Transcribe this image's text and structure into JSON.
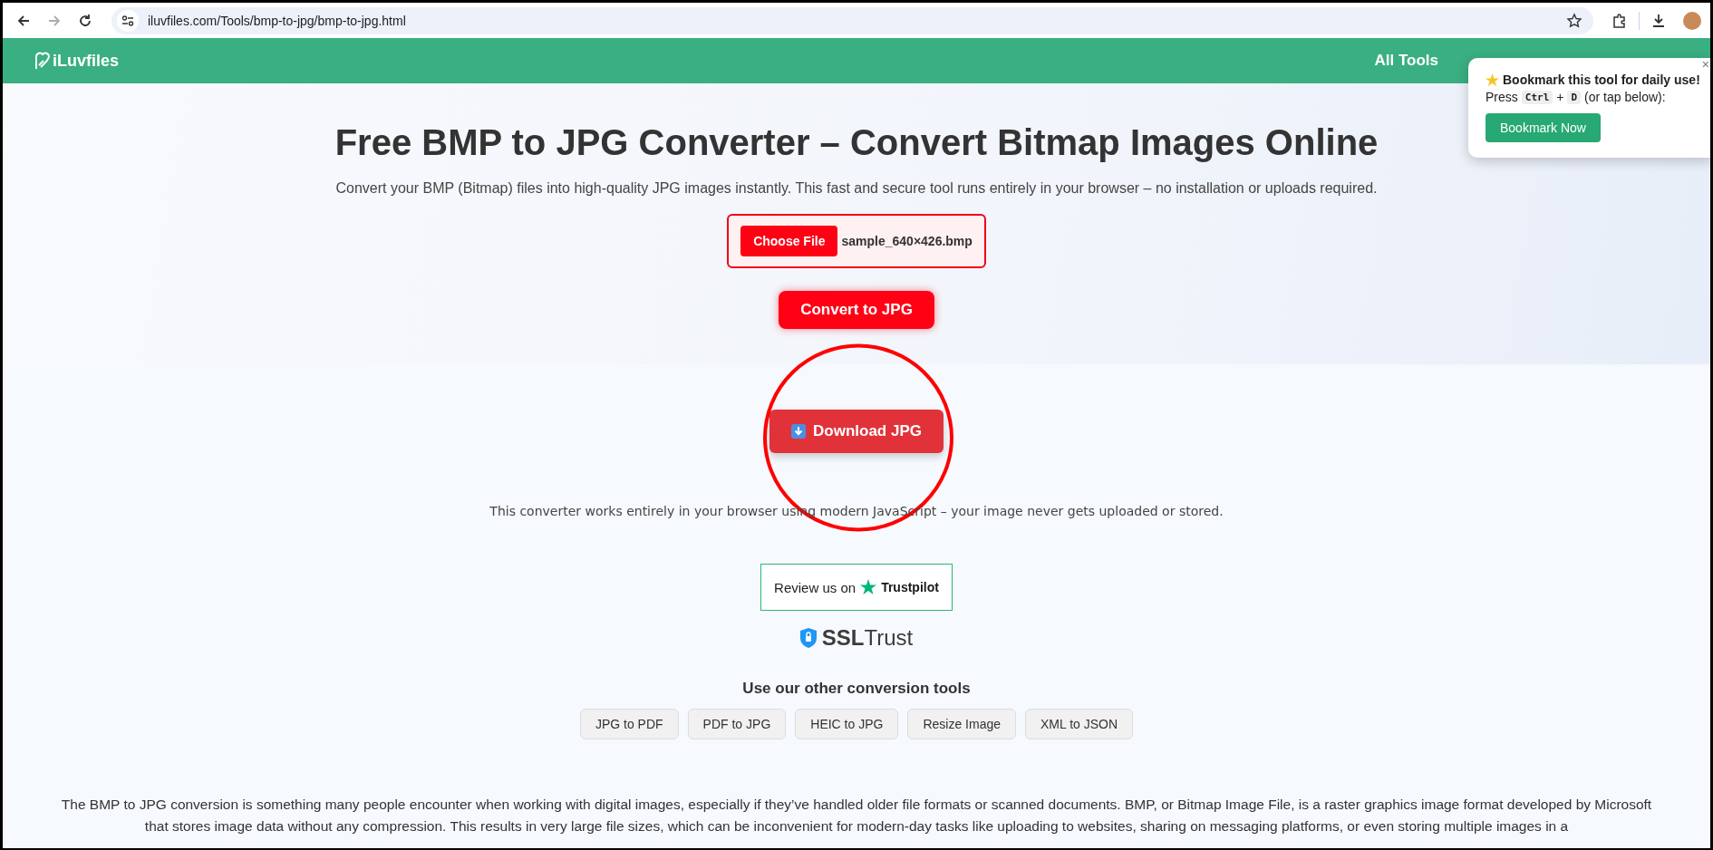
{
  "browser": {
    "url": "iluvfiles.com/Tools/bmp-to-jpg/bmp-to-jpg.html",
    "forward_disabled": true
  },
  "header": {
    "logo": "iLuvfiles",
    "nav": [
      "All Tools"
    ]
  },
  "hero": {
    "title": "Free BMP to JPG Converter – Convert Bitmap Images Online",
    "subtitle": "Convert your BMP (Bitmap) files into high-quality JPG images instantly. This fast and secure tool runs entirely in your browser – no installation or uploads required.",
    "file_button": "Choose File",
    "file_name": "sample_640×426.bmp",
    "convert_button": "Convert to JPG"
  },
  "download_button": "Download JPG",
  "note": "This converter works entirely in your browser using modern JavaScript – your image never gets uploaded or stored.",
  "review": {
    "text": "Review us on",
    "brand": "Trustpilot"
  },
  "ssl": {
    "bold": "SSL",
    "rest": "Trust"
  },
  "tools": {
    "heading": "Use our other conversion tools",
    "links": [
      "JPG to PDF",
      "PDF to JPG",
      "HEIC to JPG",
      "Resize Image",
      "XML to JSON"
    ]
  },
  "article": "The BMP to JPG conversion is something many people encounter when working with digital images, especially if they’ve handled older file formats or scanned documents. BMP, or Bitmap Image File, is a raster graphics image format developed by Microsoft that stores image data without any compression. This results in very large file sizes, which can be inconvenient for modern-day tasks like uploading to websites, sharing on messaging platforms, or even storing multiple images in a",
  "popup": {
    "title": "Bookmark this tool for daily use!",
    "press": "Press",
    "key_1": "Ctrl",
    "plus": "+",
    "key_2": "D",
    "hint": "(or tap below):",
    "button": "Bookmark Now",
    "close": "×"
  }
}
